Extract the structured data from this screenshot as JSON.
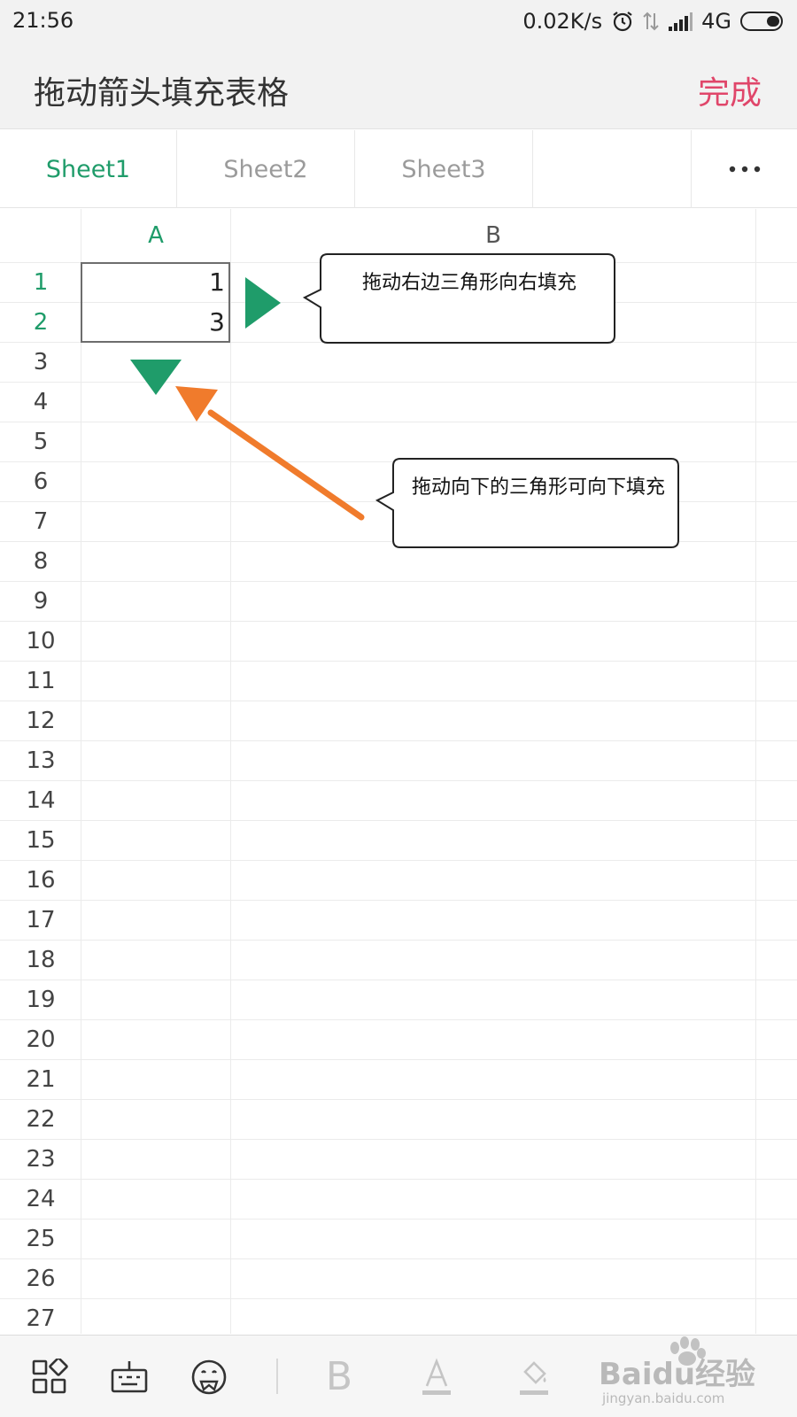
{
  "status_bar": {
    "time": "21:56",
    "network_speed": "0.02K/s",
    "network_type": "4G"
  },
  "header": {
    "title": "拖动箭头填充表格",
    "done_label": "完成"
  },
  "tabs": [
    {
      "label": "Sheet1",
      "active": true
    },
    {
      "label": "Sheet2",
      "active": false
    },
    {
      "label": "Sheet3",
      "active": false
    }
  ],
  "grid": {
    "columns": [
      "A",
      "B"
    ],
    "rows": [
      "1",
      "2",
      "3",
      "4",
      "5",
      "6",
      "7",
      "8",
      "9",
      "10",
      "11",
      "12",
      "13",
      "14",
      "15",
      "16",
      "17",
      "18",
      "19",
      "20",
      "21",
      "22",
      "23",
      "24",
      "25",
      "26",
      "27"
    ],
    "cells": {
      "A1": "1",
      "A2": "3"
    }
  },
  "callouts": {
    "right_fill": "拖动右边三角形向右填充",
    "down_fill": "拖动向下的三角形可向下填充"
  },
  "toolbar": {
    "bold_label": "B"
  },
  "watermark": {
    "brand": "Baidu经验",
    "domain": "jingyan.baidu.com"
  },
  "colors": {
    "accent": "#1f9c6a",
    "done": "#e0466a",
    "arrow": "#f07b2c"
  }
}
